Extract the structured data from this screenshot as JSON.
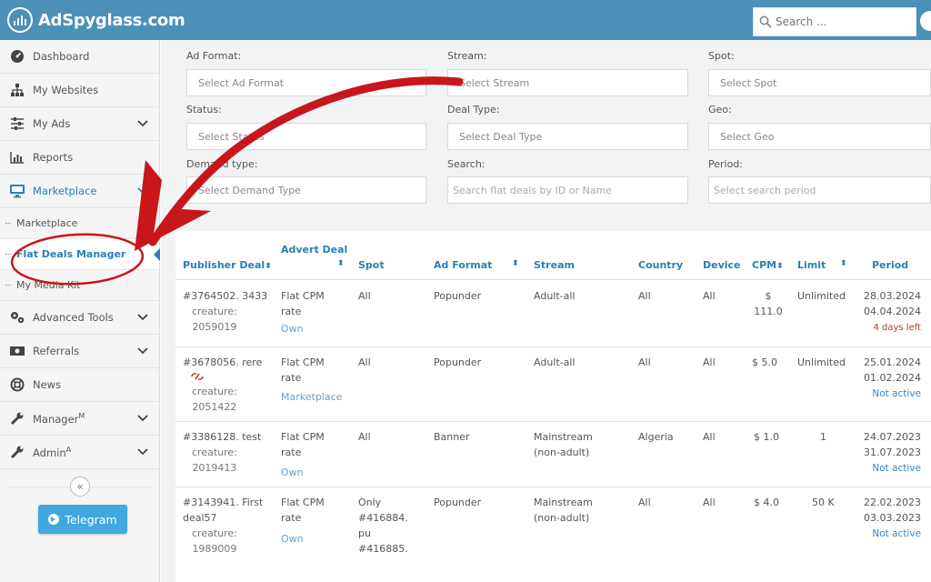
{
  "app": {
    "title": "AdSpyglass.com"
  },
  "search": {
    "placeholder": "Search ..."
  },
  "sidebar": {
    "items": [
      {
        "label": "Dashboard"
      },
      {
        "label": "My Websites"
      },
      {
        "label": "My Ads"
      },
      {
        "label": "Reports"
      },
      {
        "label": "Marketplace"
      },
      {
        "label": "Advanced Tools"
      },
      {
        "label": "Referrals"
      },
      {
        "label": "News"
      },
      {
        "label": "Manager",
        "sup": "M"
      },
      {
        "label": "Admin",
        "sup": "A"
      }
    ],
    "subitems": [
      {
        "label": "Marketplace"
      },
      {
        "label": "Flat Deals Manager"
      },
      {
        "label": "My Media Kit"
      }
    ],
    "collapse_label": "«",
    "telegram_label": "Telegram"
  },
  "filters": [
    {
      "label": "Ad Format:",
      "placeholder": "Select Ad Format"
    },
    {
      "label": "Stream:",
      "placeholder": "Select Stream"
    },
    {
      "label": "Spot:",
      "placeholder": "Select Spot"
    },
    {
      "label": "Status:",
      "placeholder": "Select Status"
    },
    {
      "label": "Deal Type:",
      "placeholder": "Select Deal Type"
    },
    {
      "label": "Geo:",
      "placeholder": "Select Geo"
    },
    {
      "label": "Demand type:",
      "placeholder": "Select Demand Type"
    },
    {
      "label": "Search:",
      "placeholder": "Search flat deals by ID or Name"
    },
    {
      "label": "Period:",
      "placeholder": "Select search period"
    }
  ],
  "table": {
    "headers": [
      "Publisher Deal",
      "Advert Deal",
      "Spot",
      "Ad Format",
      "Stream",
      "Country",
      "Device",
      "CPM",
      "Limit",
      "Period"
    ],
    "sort_glyph": "⬍",
    "rows": [
      {
        "publisher_deal": "#3764502. 3433",
        "creature_label": "creature:",
        "creature": "2059019",
        "advert_deal": [
          "Flat CPM",
          "rate"
        ],
        "advert_source": "Own",
        "spot": [
          "All"
        ],
        "ad_format": "Popunder",
        "stream": [
          "Adult-all"
        ],
        "country": "All",
        "device": "All",
        "cpm": [
          "$",
          "111.0"
        ],
        "limit": "Unlimited",
        "period": [
          "28.03.2024",
          "04.04.2024"
        ],
        "status": "4 days left",
        "status_color": "#c0392b"
      },
      {
        "publisher_deal": "#3678056. rere",
        "creature_label": "creature:",
        "creature": "2051422",
        "advert_deal": [
          "Flat CPM",
          "rate"
        ],
        "advert_source": "Marketplace",
        "spot": [
          "All"
        ],
        "ad_format": "Popunder",
        "stream": [
          "Adult-all"
        ],
        "country": "All",
        "device": "All",
        "cpm": [
          "$ 5.0"
        ],
        "limit": "Unlimited",
        "period": [
          "25.01.2024",
          "01.02.2024"
        ],
        "status": "Not active",
        "status_color": "#3a86c4"
      },
      {
        "publisher_deal": "#3386128. test",
        "creature_label": "creature:",
        "creature": "2019413",
        "advert_deal": [
          "Flat CPM",
          "rate"
        ],
        "advert_source": "Own",
        "spot": [
          "All"
        ],
        "ad_format": "Banner",
        "stream": [
          "Mainstream",
          "(non-adult)"
        ],
        "country": "Algeria",
        "device": "All",
        "cpm": [
          "$ 1.0"
        ],
        "limit": "1",
        "period": [
          "24.07.2023",
          "31.07.2023"
        ],
        "status": "Not active",
        "status_color": "#3a86c4"
      },
      {
        "publisher_deal": "#3143941. First",
        "publisher_deal_2": "deal57",
        "creature_label": "creature:",
        "creature": "1989009",
        "advert_deal": [
          "Flat CPM",
          "rate"
        ],
        "advert_source": "Own",
        "spot": [
          "Only",
          "#416884.",
          "pu",
          "#416885."
        ],
        "ad_format": "Popunder",
        "stream": [
          "Mainstream",
          "(non-adult)"
        ],
        "country": "All",
        "device": "All",
        "cpm": [
          "$ 4.0"
        ],
        "limit": "50 K",
        "period": [
          "22.02.2023",
          "03.03.2023"
        ],
        "status": "Not active",
        "status_color": "#3a86c4"
      }
    ]
  },
  "colors": {
    "topbar": "#4a90b8",
    "accent": "#2b7fb4",
    "telegram": "#3fa9e0",
    "annotation": "#c8161d"
  }
}
